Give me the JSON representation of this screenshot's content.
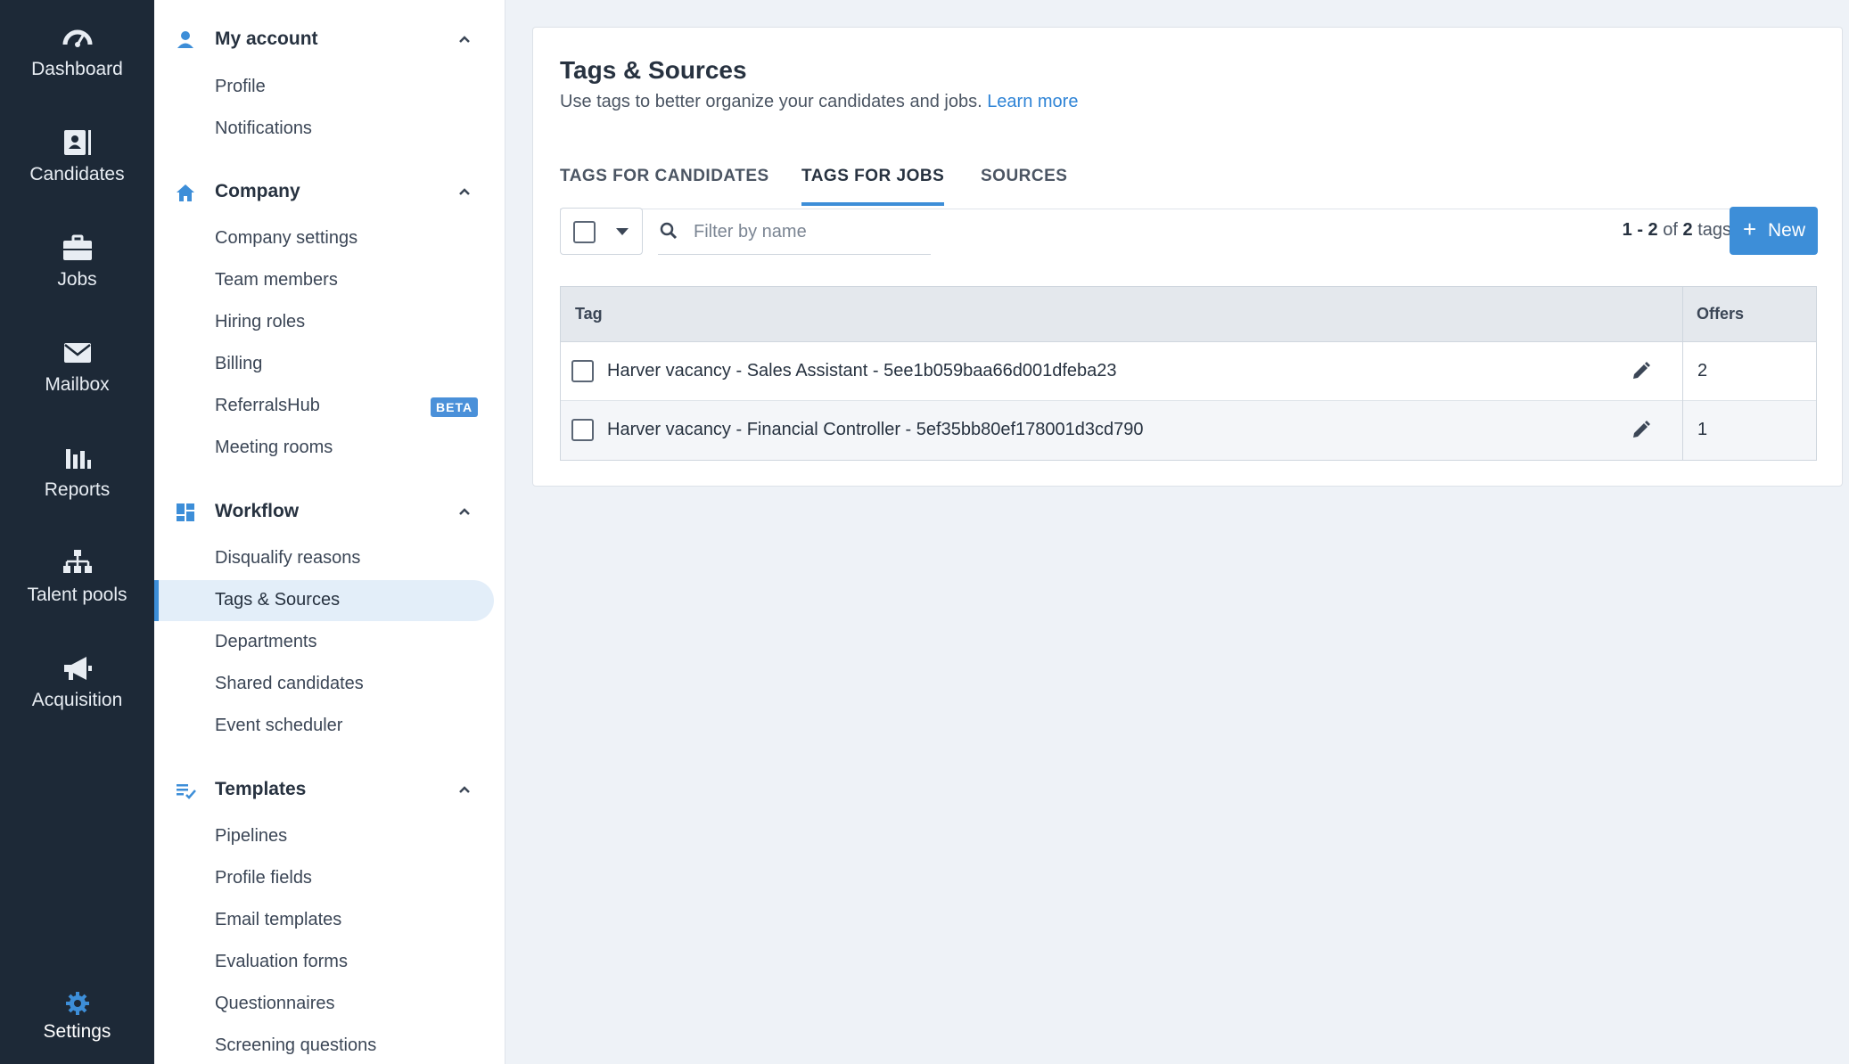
{
  "nav": {
    "items": [
      {
        "label": "Dashboard",
        "icon": "gauge-icon"
      },
      {
        "label": "Candidates",
        "icon": "id-card-icon"
      },
      {
        "label": "Jobs",
        "icon": "briefcase-icon"
      },
      {
        "label": "Mailbox",
        "icon": "envelope-icon"
      },
      {
        "label": "Reports",
        "icon": "bar-chart-icon"
      },
      {
        "label": "Talent pools",
        "icon": "hierarchy-icon"
      },
      {
        "label": "Acquisition",
        "icon": "megaphone-icon"
      }
    ],
    "settings": {
      "label": "Settings",
      "icon": "gear-icon"
    }
  },
  "sidebar": {
    "sections": [
      {
        "title": "My account",
        "icon": "person-icon",
        "items": [
          "Profile",
          "Notifications"
        ]
      },
      {
        "title": "Company",
        "icon": "home-icon",
        "items": [
          "Company settings",
          "Team members",
          "Hiring roles",
          "Billing",
          "ReferralsHub",
          "Meeting rooms"
        ]
      },
      {
        "title": "Workflow",
        "icon": "dashboard-grid-icon",
        "items": [
          "Disqualify reasons",
          "Tags & Sources",
          "Departments",
          "Shared candidates",
          "Event scheduler"
        ]
      },
      {
        "title": "Templates",
        "icon": "checklist-icon",
        "items": [
          "Pipelines",
          "Profile fields",
          "Email templates",
          "Evaluation forms",
          "Questionnaires",
          "Screening questions"
        ]
      }
    ],
    "beta_badge": "BETA",
    "active_item": "Tags & Sources"
  },
  "main": {
    "title": "Tags & Sources",
    "subtitle": "Use tags to better organize your candidates and jobs.",
    "learn_more": "Learn more",
    "tabs": [
      {
        "label": "TAGS FOR CANDIDATES"
      },
      {
        "label": "TAGS FOR JOBS"
      },
      {
        "label": "SOURCES"
      }
    ],
    "active_tab": "TAGS FOR JOBS",
    "filter_placeholder": "Filter by name",
    "count": {
      "range": "1 - 2",
      "of": "of",
      "total": "2",
      "unit": "tags"
    },
    "new_button": "New",
    "table": {
      "headers": {
        "tag": "Tag",
        "offers": "Offers"
      },
      "rows": [
        {
          "tag": "Harver vacancy - Sales Assistant - 5ee1b059baa66d001dfeba23",
          "offers": "2"
        },
        {
          "tag": "Harver vacancy - Financial Controller - 5ef35bb80ef178001d3cd790",
          "offers": "1"
        }
      ]
    }
  },
  "colors": {
    "accent": "#3d8ed8",
    "nav_bg": "#1d2937",
    "active_bg": "#e3eef9",
    "page_bg": "#eef2f7"
  }
}
